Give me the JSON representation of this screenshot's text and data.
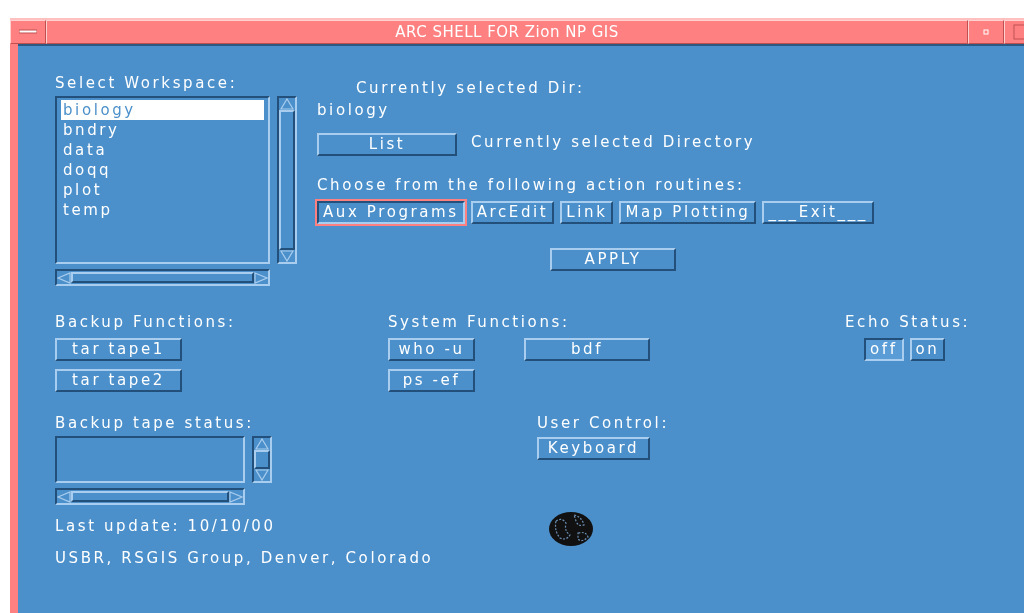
{
  "window": {
    "title": "ARC SHELL FOR Zion NP GIS"
  },
  "workspace": {
    "label": "Select Workspace:",
    "items": [
      {
        "label": "biology",
        "selected": true
      },
      {
        "label": "bndry",
        "selected": false
      },
      {
        "label": "data",
        "selected": false
      },
      {
        "label": "doqq",
        "selected": false
      },
      {
        "label": "plot",
        "selected": false
      },
      {
        "label": "temp",
        "selected": false
      }
    ]
  },
  "directory": {
    "label": "Currently selected Dir:",
    "value": "biology",
    "list_button": "List",
    "caption": "Currently selected Directory"
  },
  "actions": {
    "label": "Choose from the following action routines:",
    "buttons": [
      {
        "label": "Aux Programs",
        "selected": true
      },
      {
        "label": "ArcEdit",
        "selected": false
      },
      {
        "label": "Link",
        "selected": false
      },
      {
        "label": "Map Plotting",
        "selected": false
      },
      {
        "label": "___Exit___",
        "selected": false
      }
    ],
    "apply": "APPLY"
  },
  "backup": {
    "label": "Backup Functions:",
    "buttons": [
      "tar tape1",
      "tar tape2"
    ]
  },
  "system": {
    "label": "System Functions:",
    "buttons": [
      "who -u",
      "bdf",
      "ps -ef"
    ]
  },
  "echo": {
    "label": "Echo Status:",
    "options": [
      {
        "label": "off",
        "selected": true
      },
      {
        "label": "on",
        "selected": false
      }
    ]
  },
  "tape_status": {
    "label": "Backup tape status:"
  },
  "user_control": {
    "label": "User Control:",
    "button": "Keyboard"
  },
  "last_update": "Last update: 10/10/00",
  "footer": "USBR, RSGIS Group, Denver, Colorado"
}
